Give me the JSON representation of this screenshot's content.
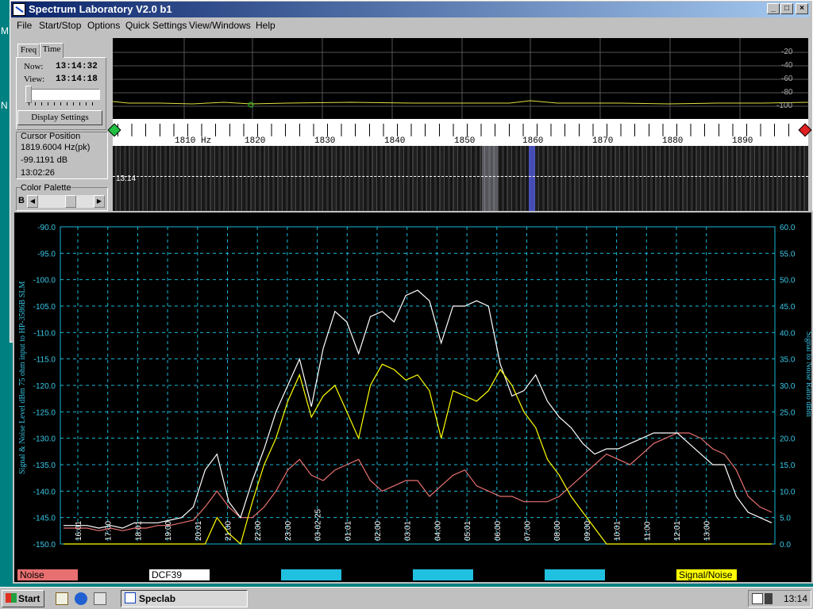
{
  "window": {
    "title": "Spectrum Laboratory V2.0 b1",
    "min_glyph": "_",
    "max_glyph": "□",
    "close_glyph": "×"
  },
  "menu": [
    "File",
    "Start/Stop",
    "Options",
    "Quick Settings",
    "View/Windows",
    "Help"
  ],
  "desktop_letters": [
    "M",
    "N"
  ],
  "left_panel": {
    "tabs": [
      "Freq",
      "Time"
    ],
    "now_label": "Now:",
    "now_value": "13:14:32",
    "view_label": "View:",
    "view_value": "13:14:18",
    "display_settings": "Display Settings",
    "cursor_group": "Cursor Position",
    "cursor_freq": "1819.6004 Hz(pk)",
    "cursor_level": "-99.1191 dB",
    "cursor_time": "13:02:26",
    "palette_group": "Color Palette",
    "palette_b": "B"
  },
  "spectrum": {
    "db_labels": [
      "-20",
      "-40",
      "-60",
      "-80",
      "-100"
    ],
    "freq_labels": [
      "1810 Hz",
      "1820",
      "1830",
      "1840",
      "1850",
      "1860",
      "1870",
      "1880",
      "1890"
    ],
    "waterfall_time": "13:14"
  },
  "colors": {
    "noise": "#e87070",
    "dcf39": "#ffffff",
    "snr": "#ffff00",
    "grid": "#18b8d8",
    "axis_text": "#38c8e8"
  },
  "chart_data": {
    "type": "line",
    "ylabel": "Signal & Noise Level  dBm 75 ohm input to HP-3586B SLM",
    "y2label": "Signal to Noise Ratio  dBm",
    "y_ticks": [
      "-90.0",
      "-95.0",
      "-100.0",
      "-105.0",
      "-110.0",
      "-115.0",
      "-120.0",
      "-125.0",
      "-130.0",
      "-135.0",
      "-140.0",
      "-145.0",
      "-150.0"
    ],
    "y2_ticks": [
      "60.0",
      "55.0",
      "50.0",
      "45.0",
      "40.0",
      "35.0",
      "30.0",
      "25.0",
      "20.0",
      "15.0",
      "10.0",
      "5.0",
      "0.0"
    ],
    "ylim": [
      -150,
      -90
    ],
    "y2lim": [
      0,
      60
    ],
    "x_ticks": [
      "16:01",
      "17:00",
      "18:01",
      "19:00",
      "20:01",
      "21:00",
      "22:00",
      "23:00",
      "03-02-25",
      "01:01",
      "02:00",
      "03:01",
      "04:00",
      "05:01",
      "06:00",
      "07:00",
      "08:00",
      "09:00",
      "10:01",
      "11:00",
      "12:01",
      "13:00"
    ],
    "series": [
      {
        "name": "Noise",
        "color": "#e87070",
        "axis": "left",
        "values": [
          -147,
          -147,
          -147,
          -147.5,
          -147,
          -147.5,
          -147,
          -147,
          -146.5,
          -146.5,
          -146,
          -145.5,
          -143,
          -140,
          -143,
          -145,
          -145,
          -143,
          -140,
          -136,
          -134,
          -137,
          -138,
          -136,
          -135,
          -134,
          -138,
          -140,
          -139,
          -138,
          -138,
          -141,
          -139,
          -137,
          -136,
          -139,
          -140,
          -141,
          -141,
          -142,
          -142,
          -142,
          -141,
          -139,
          -137,
          -135,
          -133,
          -134,
          -135,
          -133,
          -131,
          -130,
          -129,
          -129,
          -130,
          -132,
          -133,
          -136,
          -141,
          -143,
          -144
        ]
      },
      {
        "name": "DCF39",
        "color": "#ffffff",
        "axis": "left",
        "values": [
          -146.5,
          -146.5,
          -146.5,
          -147,
          -146.5,
          -147,
          -146,
          -146,
          -146,
          -145.5,
          -145,
          -143,
          -136,
          -133,
          -142,
          -145,
          -138,
          -132,
          -125,
          -120,
          -115,
          -124,
          -113,
          -106,
          -108,
          -114,
          -107,
          -106,
          -108,
          -103,
          -102,
          -104,
          -112,
          -105,
          -105,
          -104,
          -105,
          -116,
          -122,
          -121,
          -118,
          -123,
          -126,
          -128,
          -131,
          -133,
          -132,
          -132,
          -131,
          -130,
          -129,
          -129,
          -129,
          -131,
          -133,
          -135,
          -135,
          -141,
          -144,
          -145,
          -146
        ]
      },
      {
        "name": "Signal/Noise",
        "color": "#ffff00",
        "axis": "right",
        "values": [
          0,
          0,
          0,
          0,
          0,
          0,
          0,
          0,
          0,
          0,
          0,
          0,
          0,
          5,
          2,
          0,
          8,
          15,
          20,
          27,
          32,
          24,
          28,
          30,
          25,
          20,
          30,
          34,
          33,
          31,
          32,
          29,
          20,
          29,
          28,
          27,
          29,
          33,
          30,
          25,
          22,
          16,
          13,
          9,
          6,
          3,
          0,
          0,
          0,
          0,
          0,
          0,
          0,
          0,
          0,
          0,
          0,
          0,
          0,
          0,
          0
        ]
      }
    ],
    "legend": [
      "Noise",
      "DCF39",
      "",
      "",
      "",
      "Signal/Noise"
    ]
  },
  "taskbar": {
    "start": "Start",
    "app": "Speclab",
    "clock": "13:14"
  }
}
